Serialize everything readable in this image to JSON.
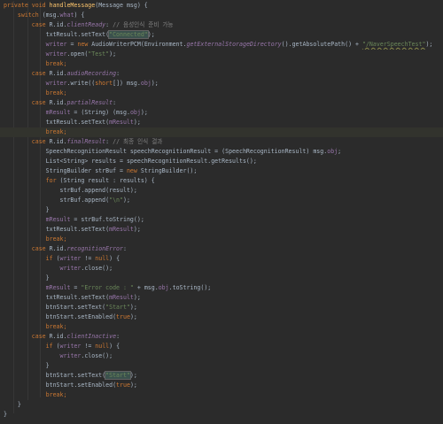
{
  "editor": {
    "lines": [
      [
        {
          "t": "private void ",
          "c": "kw"
        },
        {
          "t": "handleMessage",
          "c": "fn"
        },
        {
          "t": "(Message msg) {",
          "c": ""
        }
      ],
      [
        {
          "t": "    ",
          "c": ""
        },
        {
          "t": "switch ",
          "c": "kw"
        },
        {
          "t": "(msg.",
          "c": ""
        },
        {
          "t": "what",
          "c": "fld"
        },
        {
          "t": ") {",
          "c": ""
        }
      ],
      [
        {
          "t": "        ",
          "c": ""
        },
        {
          "t": "case ",
          "c": "kw"
        },
        {
          "t": "R.id.",
          "c": ""
        },
        {
          "t": "clientReady",
          "c": "kwfld"
        },
        {
          "t": ": ",
          "c": ""
        },
        {
          "t": "// 음성인식 준비 가능",
          "c": "cm"
        }
      ],
      [
        {
          "t": "            txtResult.setText(",
          "c": ""
        },
        {
          "t": "\"Connected\"",
          "c": "match"
        },
        {
          "t": ");",
          "c": ""
        }
      ],
      [
        {
          "t": "            ",
          "c": ""
        },
        {
          "t": "writer",
          "c": "fld"
        },
        {
          "t": " = ",
          "c": ""
        },
        {
          "t": "new ",
          "c": "kw"
        },
        {
          "t": "AudioWriterPCM(Environment.",
          "c": ""
        },
        {
          "t": "getExternalStorageDirectory",
          "c": "kwfld"
        },
        {
          "t": "().getAbsolutePath() + ",
          "c": ""
        },
        {
          "t": "\"/NaverSpeechTest\"",
          "c": "warn"
        },
        {
          "t": ");",
          "c": ""
        }
      ],
      [
        {
          "t": "            ",
          "c": ""
        },
        {
          "t": "writer",
          "c": "fld"
        },
        {
          "t": ".open(",
          "c": ""
        },
        {
          "t": "\"Test\"",
          "c": "str"
        },
        {
          "t": ");",
          "c": ""
        }
      ],
      [
        {
          "t": "            ",
          "c": ""
        },
        {
          "t": "break;",
          "c": "kw"
        }
      ],
      [
        {
          "t": "        ",
          "c": ""
        },
        {
          "t": "case ",
          "c": "kw"
        },
        {
          "t": "R.id.",
          "c": ""
        },
        {
          "t": "audioRecording",
          "c": "kwfld"
        },
        {
          "t": ":",
          "c": ""
        }
      ],
      [
        {
          "t": "            ",
          "c": ""
        },
        {
          "t": "writer",
          "c": "fld"
        },
        {
          "t": ".write((",
          "c": ""
        },
        {
          "t": "short",
          "c": "kw"
        },
        {
          "t": "[]) msg.",
          "c": ""
        },
        {
          "t": "obj",
          "c": "fld"
        },
        {
          "t": ");",
          "c": ""
        }
      ],
      [
        {
          "t": "            ",
          "c": ""
        },
        {
          "t": "break;",
          "c": "kw"
        }
      ],
      [
        {
          "t": "        ",
          "c": ""
        },
        {
          "t": "case ",
          "c": "kw"
        },
        {
          "t": "R.id.",
          "c": ""
        },
        {
          "t": "partialResult",
          "c": "kwfld"
        },
        {
          "t": ":",
          "c": ""
        }
      ],
      [
        {
          "t": "            ",
          "c": ""
        },
        {
          "t": "mResult",
          "c": "fld"
        },
        {
          "t": " = (String) (msg.",
          "c": ""
        },
        {
          "t": "obj",
          "c": "fld"
        },
        {
          "t": ");",
          "c": ""
        }
      ],
      [
        {
          "t": "            txtResult.setText(",
          "c": ""
        },
        {
          "t": "mResult",
          "c": "fld"
        },
        {
          "t": ");",
          "c": ""
        }
      ],
      [
        {
          "t": "            ",
          "c": ""
        },
        {
          "t": "break;",
          "c": "kw"
        }
      ],
      [
        {
          "t": "        ",
          "c": ""
        },
        {
          "t": "case ",
          "c": "kw"
        },
        {
          "t": "R.id.",
          "c": ""
        },
        {
          "t": "finalResult",
          "c": "kwfld"
        },
        {
          "t": ": ",
          "c": ""
        },
        {
          "t": "// 최종 인식 결과",
          "c": "cm"
        }
      ],
      [
        {
          "t": "            SpeechRecognitionResult speechRecognitionResult = (SpeechRecognitionResult) msg.",
          "c": ""
        },
        {
          "t": "obj",
          "c": "fld"
        },
        {
          "t": ";",
          "c": ""
        }
      ],
      [
        {
          "t": "            List<String> results = speechRecognitionResult.getResults();",
          "c": ""
        }
      ],
      [
        {
          "t": "            StringBuilder strBuf = ",
          "c": ""
        },
        {
          "t": "new ",
          "c": "kw"
        },
        {
          "t": "StringBuilder();",
          "c": ""
        }
      ],
      [
        {
          "t": "            ",
          "c": ""
        },
        {
          "t": "for ",
          "c": "kw"
        },
        {
          "t": "(String result : results) {",
          "c": ""
        }
      ],
      [
        {
          "t": "                strBuf.append(result);",
          "c": ""
        }
      ],
      [
        {
          "t": "                strBuf.append(",
          "c": ""
        },
        {
          "t": "\"\\n\"",
          "c": "str"
        },
        {
          "t": ");",
          "c": ""
        }
      ],
      [
        {
          "t": "            }",
          "c": ""
        }
      ],
      [
        {
          "t": "            ",
          "c": ""
        },
        {
          "t": "mResult",
          "c": "fld"
        },
        {
          "t": " = strBuf.toString();",
          "c": ""
        }
      ],
      [
        {
          "t": "            txtResult.setText(",
          "c": ""
        },
        {
          "t": "mResult",
          "c": "fld"
        },
        {
          "t": ");",
          "c": ""
        }
      ],
      [
        {
          "t": "            ",
          "c": ""
        },
        {
          "t": "break;",
          "c": "kw"
        }
      ],
      [
        {
          "t": "        ",
          "c": ""
        },
        {
          "t": "case ",
          "c": "kw"
        },
        {
          "t": "R.id.",
          "c": ""
        },
        {
          "t": "recognitionError",
          "c": "kwfld"
        },
        {
          "t": ":",
          "c": ""
        }
      ],
      [
        {
          "t": "            ",
          "c": ""
        },
        {
          "t": "if ",
          "c": "kw"
        },
        {
          "t": "(",
          "c": ""
        },
        {
          "t": "writer",
          "c": "fld"
        },
        {
          "t": " != ",
          "c": ""
        },
        {
          "t": "null",
          "c": "kw"
        },
        {
          "t": ") {",
          "c": ""
        }
      ],
      [
        {
          "t": "                ",
          "c": ""
        },
        {
          "t": "writer",
          "c": "fld"
        },
        {
          "t": ".close();",
          "c": ""
        }
      ],
      [
        {
          "t": "            }",
          "c": ""
        }
      ],
      [
        {
          "t": "            ",
          "c": ""
        },
        {
          "t": "mResult",
          "c": "fld"
        },
        {
          "t": " = ",
          "c": ""
        },
        {
          "t": "\"Error code : \"",
          "c": "str"
        },
        {
          "t": " + msg.",
          "c": ""
        },
        {
          "t": "obj",
          "c": "fld"
        },
        {
          "t": ".toString();",
          "c": ""
        }
      ],
      [
        {
          "t": "            txtResult.setText(",
          "c": ""
        },
        {
          "t": "mResult",
          "c": "fld"
        },
        {
          "t": ");",
          "c": ""
        }
      ],
      [
        {
          "t": "            btnStart.setText(",
          "c": ""
        },
        {
          "t": "\"Start\"",
          "c": "str"
        },
        {
          "t": ");",
          "c": ""
        }
      ],
      [
        {
          "t": "            btnStart.setEnabled(",
          "c": ""
        },
        {
          "t": "true",
          "c": "kw"
        },
        {
          "t": ");",
          "c": ""
        }
      ],
      [
        {
          "t": "            ",
          "c": ""
        },
        {
          "t": "break;",
          "c": "kw"
        }
      ],
      [
        {
          "t": "        ",
          "c": ""
        },
        {
          "t": "case ",
          "c": "kw"
        },
        {
          "t": "R.id.",
          "c": ""
        },
        {
          "t": "clientInactive",
          "c": "kwfld"
        },
        {
          "t": ":",
          "c": ""
        }
      ],
      [
        {
          "t": "            ",
          "c": ""
        },
        {
          "t": "if ",
          "c": "kw"
        },
        {
          "t": "(",
          "c": ""
        },
        {
          "t": "writer",
          "c": "fld"
        },
        {
          "t": " != ",
          "c": ""
        },
        {
          "t": "null",
          "c": "kw"
        },
        {
          "t": ") {",
          "c": ""
        }
      ],
      [
        {
          "t": "                ",
          "c": ""
        },
        {
          "t": "writer",
          "c": "fld"
        },
        {
          "t": ".close();",
          "c": ""
        }
      ],
      [
        {
          "t": "            }",
          "c": ""
        }
      ],
      [
        {
          "t": "            btnStart.setText(",
          "c": ""
        },
        {
          "t": "\"Start\"",
          "c": "match"
        },
        {
          "t": ");",
          "c": ""
        }
      ],
      [
        {
          "t": "            btnStart.setEnabled(",
          "c": ""
        },
        {
          "t": "true",
          "c": "kw"
        },
        {
          "t": ");",
          "c": ""
        }
      ],
      [
        {
          "t": "            ",
          "c": ""
        },
        {
          "t": "break;",
          "c": "kw"
        }
      ],
      [
        {
          "t": "    }",
          "c": ""
        }
      ],
      [
        {
          "t": "}",
          "c": ""
        }
      ]
    ]
  },
  "colors": {
    "background": "#2b2b2b",
    "text": "#a9b7c6",
    "keyword": "#cc7832",
    "string": "#6a8759",
    "comment": "#808080",
    "method": "#ffc66d",
    "field": "#9876aa"
  }
}
